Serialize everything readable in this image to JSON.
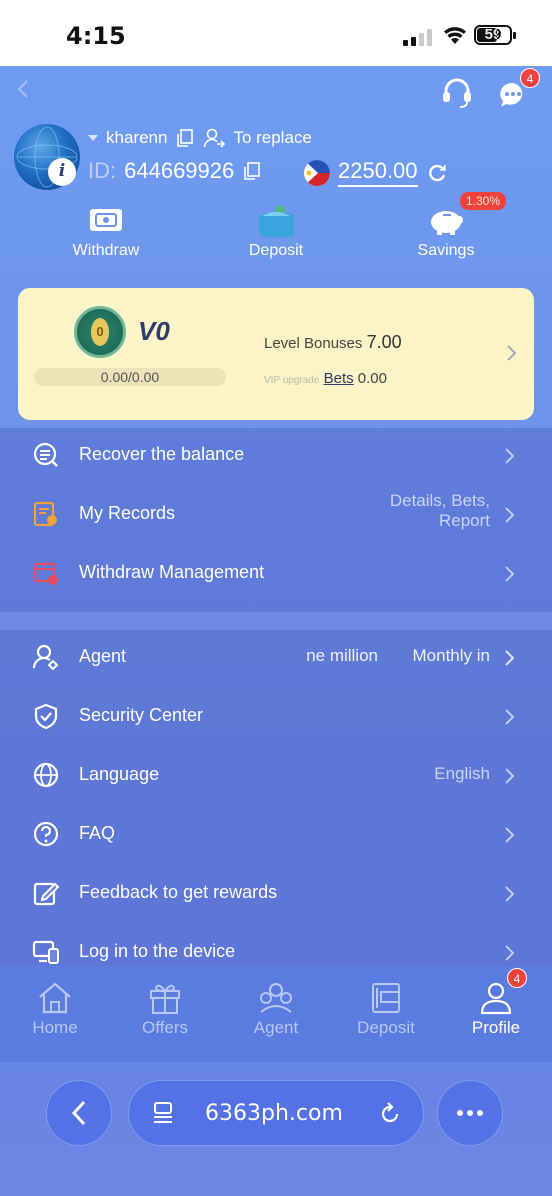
{
  "status_bar": {
    "time": "4:15",
    "battery": "59"
  },
  "header": {
    "message_badge": "4"
  },
  "profile": {
    "username": "kharenn",
    "replace_label": "To replace",
    "id_label": "ID:",
    "id_value": "644669926",
    "balance": "2250.00"
  },
  "quick_actions": {
    "withdraw": "Withdraw",
    "deposit": "Deposit",
    "savings": "Savings",
    "savings_rate": "1.30%"
  },
  "vip": {
    "level": "V0",
    "medal_digit": "0",
    "progress": "0.00/0.00",
    "bonus_label": "Level Bonuses",
    "bonus_value": "7.00",
    "faint_label": "VIP upgrade",
    "bets_label": "Bets",
    "bets_value": "0.00"
  },
  "menu_group_1": [
    {
      "label": "Recover the balance",
      "right": ""
    },
    {
      "label": "My Records",
      "right_line1": "Details, Bets,",
      "right_line2": "Report"
    },
    {
      "label": "Withdraw Management",
      "right": ""
    }
  ],
  "menu_group_2": [
    {
      "label": "Agent",
      "marquee": "ne million",
      "right": "Monthly in"
    },
    {
      "label": "Security Center",
      "right": ""
    },
    {
      "label": "Language",
      "right": "English"
    },
    {
      "label": "FAQ",
      "right": ""
    },
    {
      "label": "Feedback to get rewards",
      "right": ""
    },
    {
      "label": "Log in to the device",
      "right": ""
    }
  ],
  "tabbar": {
    "home": "Home",
    "offers": "Offers",
    "agent": "Agent",
    "deposit": "Deposit",
    "profile": "Profile",
    "profile_badge": "4"
  },
  "browser": {
    "url": "6363ph.com"
  },
  "colors": {
    "accent": "#6c8ae4",
    "badge": "#f0423c",
    "vip_card": "#fbf4c7"
  }
}
